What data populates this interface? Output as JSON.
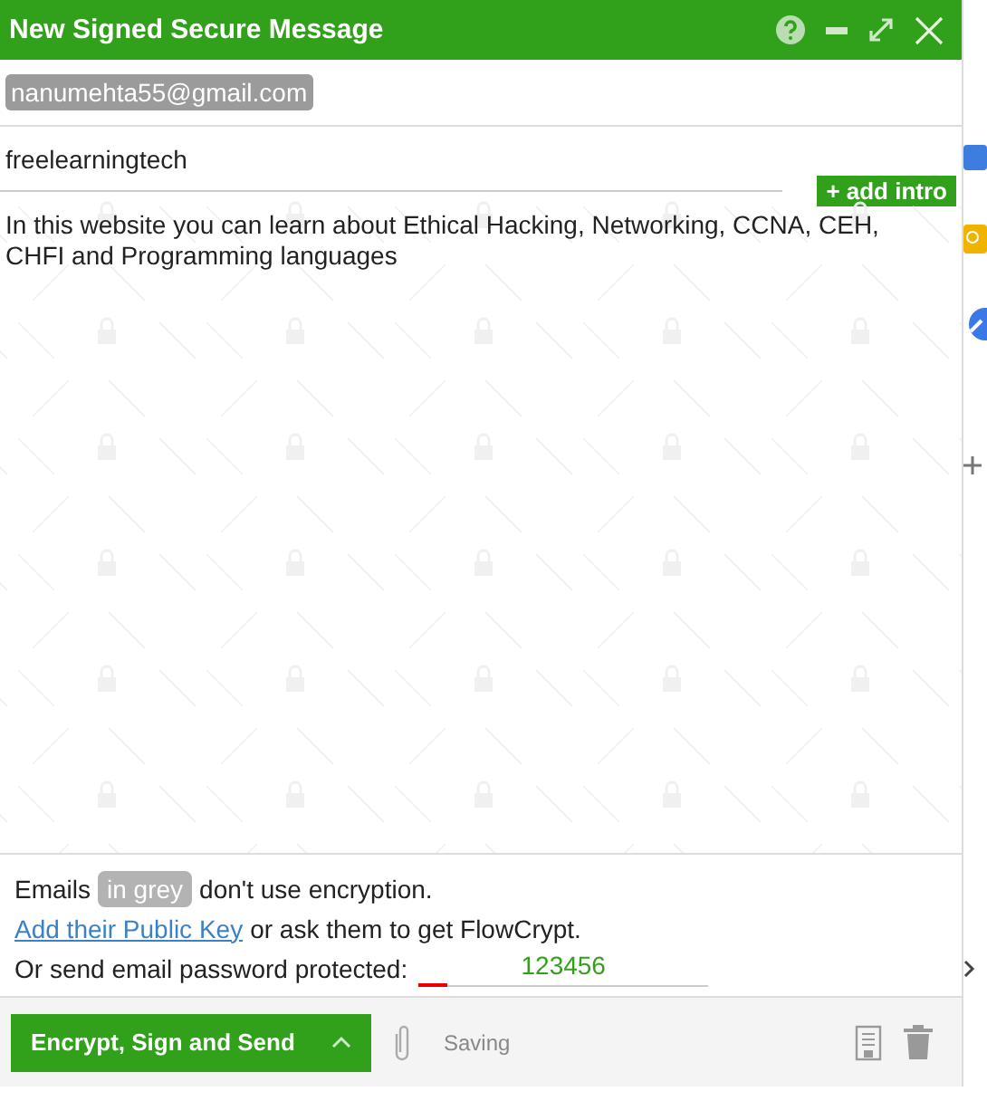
{
  "window": {
    "title": "New Signed Secure Message"
  },
  "recipients": [
    {
      "email": "nanumehta55@gmail.com"
    }
  ],
  "subject": "freelearningtech",
  "add_intro_button": "+ add intro",
  "body": "In this website you can learn about Ethical Hacking, Networking, CCNA, CEH, CHFI and Programming languages",
  "notice": {
    "prefix": "Emails",
    "badge": "in grey",
    "suffix": "don't use encryption.",
    "link": "Add their Public Key",
    "link_suffix": "or ask them to get FlowCrypt.",
    "password_label": "Or send email password protected:",
    "password": "123456",
    "strength": {
      "level": 0.1
    }
  },
  "footer": {
    "send_button": "Encrypt, Sign and Send",
    "status": "Saving"
  }
}
